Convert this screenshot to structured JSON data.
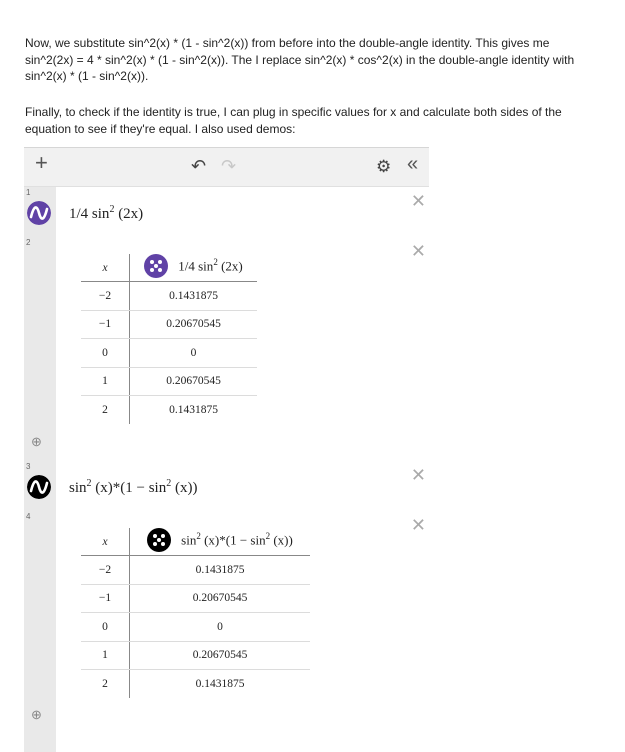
{
  "paragraphs": {
    "p1": "Now, we substitute sin^2(x) * (1 - sin^2(x)) from before into the double-angle identity. This gives me sin^2(2x) = 4 * sin^2(x) * (1 - sin^2(x)). The I replace sin^2(x) * cos^2(x) in the double-angle identity with sin^2(x) * (1 - sin^2(x)).",
    "p2": "Finally, to check if the identity is true, I can plug in specific values for x and calculate both sides of the equation to see if they're equal. I also used demos:"
  },
  "toolbar": {
    "add_icon": "+",
    "undo_icon": "↶",
    "redo_icon": "↷",
    "settings_icon": "⚙",
    "collapse_icon": "«"
  },
  "colors": {
    "purple": "#6042a6",
    "black": "#000000"
  },
  "expressions": [
    {
      "number": "1",
      "fn": "1/4 sin",
      "exp": "2",
      "arg": " (2x)"
    },
    {
      "number": "2",
      "table": {
        "xhead": "x",
        "yhead_fn": "1/4 sin",
        "yhead_exp": "2",
        "yhead_arg": " (2x)",
        "rows": [
          {
            "x": "−2",
            "y": "0.1431875"
          },
          {
            "x": "−1",
            "y": "0.20670545"
          },
          {
            "x": "0",
            "y": "0"
          },
          {
            "x": "1",
            "y": "0.20670545"
          },
          {
            "x": "2",
            "y": "0.1431875"
          }
        ]
      }
    },
    {
      "number": "3",
      "fn": "sin",
      "exp": "2",
      "arg": " (x)*(1 − sin",
      "exp2": "2",
      "arg2": " (x))"
    },
    {
      "number": "4",
      "table": {
        "xhead": "x",
        "yhead_fn": "sin",
        "yhead_exp": "2",
        "yhead_arg": " (x)*(1 − sin",
        "yhead_exp2": "2",
        "yhead_arg2": " (x))",
        "rows": [
          {
            "x": "−2",
            "y": "0.1431875"
          },
          {
            "x": "−1",
            "y": "0.20670545"
          },
          {
            "x": "0",
            "y": "0"
          },
          {
            "x": "1",
            "y": "0.20670545"
          },
          {
            "x": "2",
            "y": "0.1431875"
          }
        ]
      }
    }
  ],
  "delete_icon": "✕",
  "zoom_icon": "⊕"
}
